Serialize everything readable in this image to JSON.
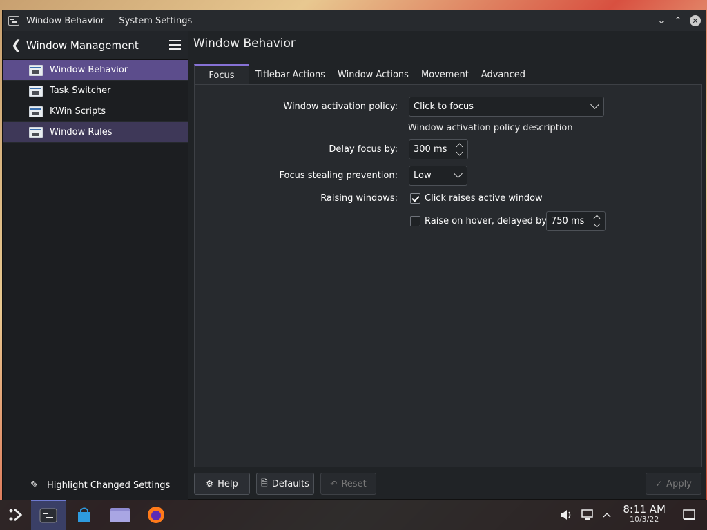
{
  "window": {
    "title": "Window Behavior — System Settings"
  },
  "sidebar": {
    "header": "Window Management",
    "items": [
      {
        "label": "Window Behavior"
      },
      {
        "label": "Task Switcher"
      },
      {
        "label": "KWin Scripts"
      },
      {
        "label": "Window Rules"
      }
    ],
    "highlight_label": "Highlight Changed Settings"
  },
  "main": {
    "title": "Window Behavior",
    "tabs": [
      {
        "label": "Focus"
      },
      {
        "label": "Titlebar Actions"
      },
      {
        "label": "Window Actions"
      },
      {
        "label": "Movement"
      },
      {
        "label": "Advanced"
      }
    ],
    "activation_policy_label": "Window activation policy:",
    "activation_policy_value": "Click to focus",
    "activation_policy_desc": "Window activation policy description",
    "delay_focus_label": "Delay focus by:",
    "delay_focus_value": "300 ms",
    "focus_stealing_label": "Focus stealing prevention:",
    "focus_stealing_value": "Low",
    "raising_label": "Raising windows:",
    "click_raises_label": "Click raises active window",
    "click_raises_checked": true,
    "raise_hover_label": "Raise on hover, delayed by:",
    "raise_hover_checked": false,
    "raise_hover_value": "750 ms"
  },
  "footer": {
    "help": "Help",
    "defaults": "Defaults",
    "reset": "Reset",
    "apply": "Apply"
  },
  "taskbar": {
    "time": "8:11 AM",
    "date": "10/3/22"
  },
  "colors": {
    "accent": "#8772d6",
    "selection": "#5c4d8c"
  }
}
